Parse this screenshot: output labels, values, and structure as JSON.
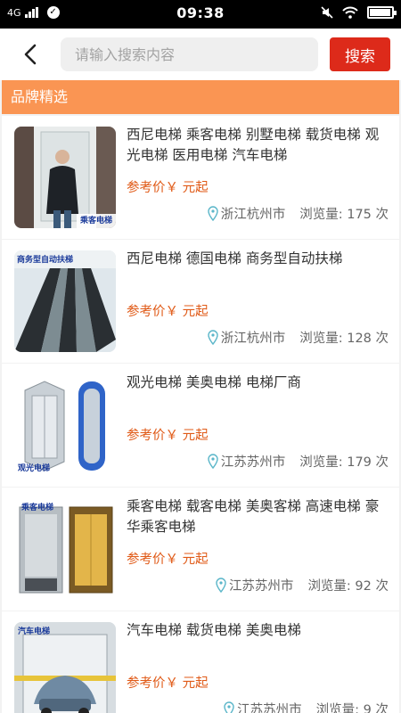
{
  "status_bar": {
    "network": "4G",
    "time": "09:38",
    "battery_level": 0.95
  },
  "header": {
    "search_placeholder": "请输入搜索内容",
    "search_button": "搜索"
  },
  "section": {
    "title": "品牌精选"
  },
  "items": [
    {
      "title": "西尼电梯 乘客电梯 别墅电梯 载货电梯 观光电梯 医用电梯 汽车电梯",
      "price": "参考价￥ 元起",
      "location": "浙江杭州市",
      "views": "浏览量: 175 次",
      "thumb_label": "乘客电梯"
    },
    {
      "title": "西尼电梯 德国电梯 商务型自动扶梯",
      "price": "参考价￥ 元起",
      "location": "浙江杭州市",
      "views": "浏览量: 128 次",
      "thumb_label": "商务型自动扶梯"
    },
    {
      "title": "观光电梯 美奥电梯 电梯厂商",
      "price": "参考价￥ 元起",
      "location": "江苏苏州市",
      "views": "浏览量: 179 次",
      "thumb_label": "观光电梯"
    },
    {
      "title": "乘客电梯 载客电梯 美奥客梯 高速电梯 豪华乘客电梯",
      "price": "参考价￥ 元起",
      "location": "江苏苏州市",
      "views": "浏览量: 92 次",
      "thumb_label": "乘客电梯"
    },
    {
      "title": "汽车电梯 载货电梯 美奥电梯",
      "price": "参考价￥ 元起",
      "location": "江苏苏州市",
      "views": "浏览量: 9 次",
      "thumb_label": "汽车电梯"
    }
  ]
}
